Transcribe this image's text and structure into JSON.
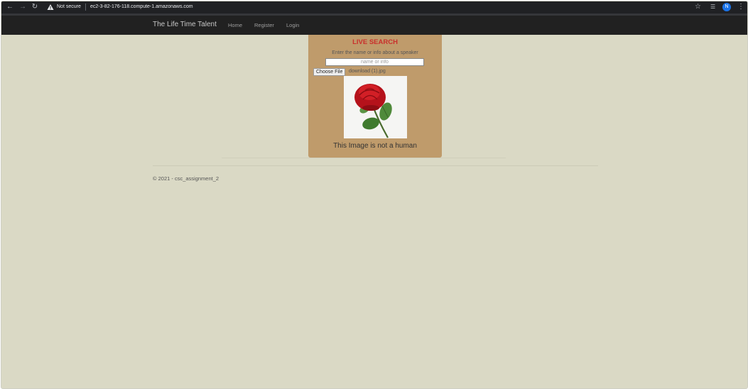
{
  "browser": {
    "security_label": "Not secure",
    "url": "ec2-3-82-176-118.compute-1.amazonaws.com",
    "avatar_letter": "N"
  },
  "navbar": {
    "brand": "The Life Time Talent",
    "links": [
      "Home",
      "Register",
      "Login"
    ]
  },
  "live_search": {
    "title": "LIVE SEARCH",
    "hint": "Enter the name or info about a speaker",
    "input_placeholder": "name or info",
    "input_value": "",
    "choose_file_label": "Choose File",
    "file_name": "download (1).jpg",
    "result_text": "This Image is not a human"
  },
  "footer": {
    "text": "© 2021 - csc_assignment_2"
  },
  "colors": {
    "page_bg": "#dad9c5",
    "panel_bg": "#bf9b6b",
    "title_red": "#c9302c",
    "navbar_bg": "#212121"
  }
}
